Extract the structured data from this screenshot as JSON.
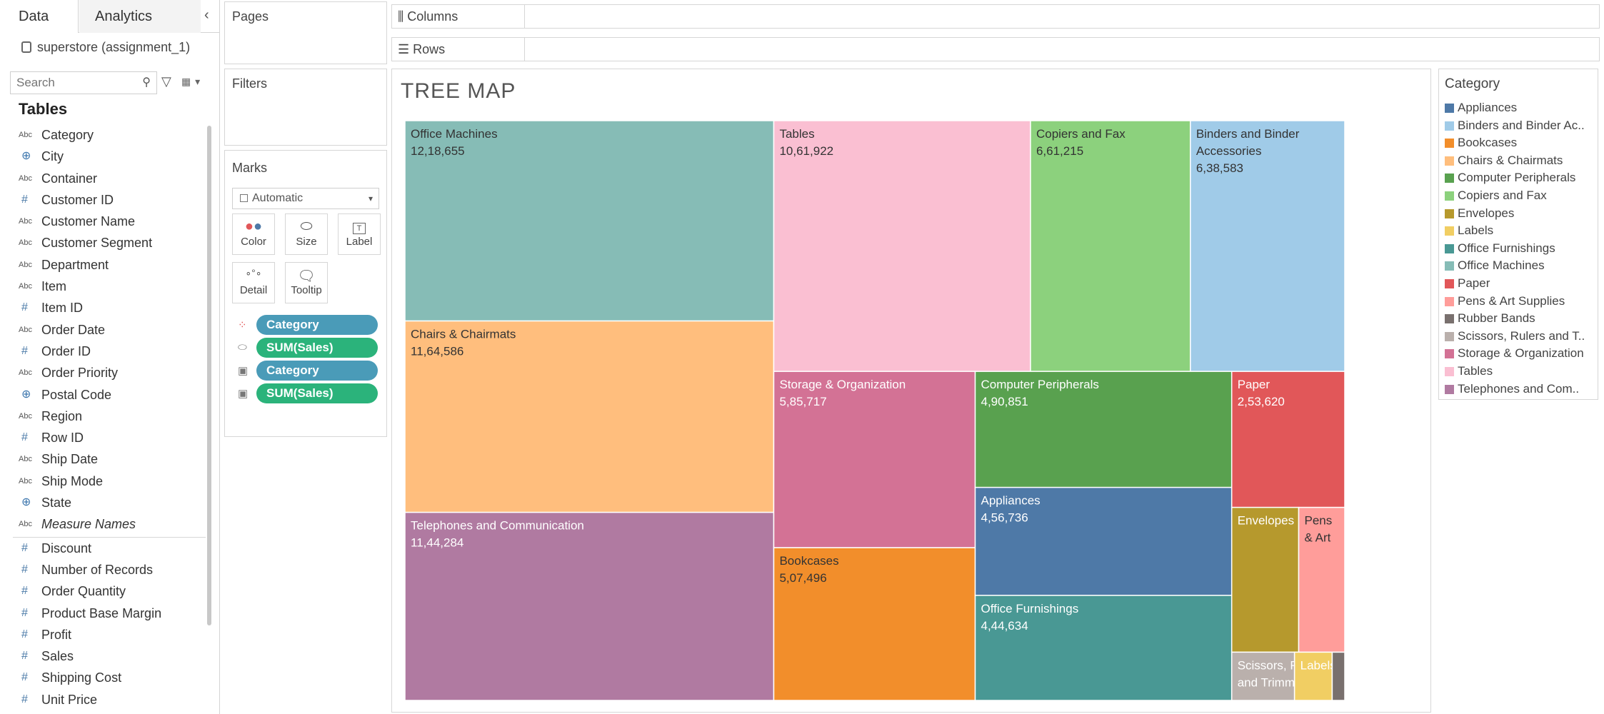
{
  "left_pane": {
    "tabs": [
      "Data",
      "Analytics"
    ],
    "datasource": "superstore (assignment_1)",
    "search_placeholder": "Search",
    "tables_title": "Tables",
    "dimensions": [
      {
        "name": "Category",
        "type": "Abc"
      },
      {
        "name": "City",
        "type": "geo"
      },
      {
        "name": "Container",
        "type": "Abc"
      },
      {
        "name": "Customer ID",
        "type": "#"
      },
      {
        "name": "Customer Name",
        "type": "Abc"
      },
      {
        "name": "Customer Segment",
        "type": "Abc"
      },
      {
        "name": "Department",
        "type": "Abc"
      },
      {
        "name": "Item",
        "type": "Abc"
      },
      {
        "name": "Item ID",
        "type": "#"
      },
      {
        "name": "Order Date",
        "type": "Abc"
      },
      {
        "name": "Order ID",
        "type": "#"
      },
      {
        "name": "Order Priority",
        "type": "Abc"
      },
      {
        "name": "Postal Code",
        "type": "geo"
      },
      {
        "name": "Region",
        "type": "Abc"
      },
      {
        "name": "Row ID",
        "type": "#"
      },
      {
        "name": "Ship Date",
        "type": "Abc"
      },
      {
        "name": "Ship Mode",
        "type": "Abc"
      },
      {
        "name": "State",
        "type": "geo"
      },
      {
        "name": "Measure Names",
        "type": "Abc",
        "italic": true
      }
    ],
    "measures": [
      {
        "name": "Discount",
        "type": "#"
      },
      {
        "name": "Number of Records",
        "type": "#"
      },
      {
        "name": "Order Quantity",
        "type": "#"
      },
      {
        "name": "Product Base Margin",
        "type": "#"
      },
      {
        "name": "Profit",
        "type": "#"
      },
      {
        "name": "Sales",
        "type": "#"
      },
      {
        "name": "Shipping Cost",
        "type": "#"
      },
      {
        "name": "Unit Price",
        "type": "#"
      }
    ]
  },
  "shelves": {
    "pages_title": "Pages",
    "filters_title": "Filters",
    "columns_label": "Columns",
    "rows_label": "Rows"
  },
  "marks": {
    "title": "Marks",
    "mark_type": "Automatic",
    "buttons": [
      "Color",
      "Size",
      "Label",
      "Detail",
      "Tooltip"
    ],
    "pills": [
      {
        "icon": "color",
        "label": "Category",
        "kind": "dim"
      },
      {
        "icon": "size",
        "label": "SUM(Sales)",
        "kind": "meas"
      },
      {
        "icon": "label",
        "label": "Category",
        "kind": "dim"
      },
      {
        "icon": "label",
        "label": "SUM(Sales)",
        "kind": "meas"
      }
    ]
  },
  "viz": {
    "title": "TREE MAP"
  },
  "legend": {
    "title": "Category",
    "items": [
      {
        "label": "Appliances",
        "color": "#4e79a7"
      },
      {
        "label": "Binders and Binder Ac..",
        "color": "#a0cbe8"
      },
      {
        "label": "Bookcases",
        "color": "#f28e2b"
      },
      {
        "label": "Chairs & Chairmats",
        "color": "#ffbe7d"
      },
      {
        "label": "Computer Peripherals",
        "color": "#59a14f"
      },
      {
        "label": "Copiers and Fax",
        "color": "#8cd17d"
      },
      {
        "label": "Envelopes",
        "color": "#b6992d"
      },
      {
        "label": "Labels",
        "color": "#f1ce63"
      },
      {
        "label": "Office Furnishings",
        "color": "#499894"
      },
      {
        "label": "Office Machines",
        "color": "#86bcb6"
      },
      {
        "label": "Paper",
        "color": "#e15759"
      },
      {
        "label": "Pens & Art Supplies",
        "color": "#ff9d9a"
      },
      {
        "label": "Rubber Bands",
        "color": "#79706e"
      },
      {
        "label": "Scissors, Rulers and T..",
        "color": "#bab0ac"
      },
      {
        "label": "Storage & Organization",
        "color": "#d37295"
      },
      {
        "label": "Tables",
        "color": "#fabfd2"
      },
      {
        "label": "Telephones and Com..",
        "color": "#b07aa1"
      }
    ]
  },
  "chart_data": {
    "type": "treemap",
    "title": "TREE MAP",
    "measure": "SUM(Sales)",
    "color_by": "Category",
    "items": [
      {
        "name": "Office Machines",
        "value": 1218655,
        "label": "12,18,655",
        "color": "#86bcb6"
      },
      {
        "name": "Chairs & Chairmats",
        "value": 1164586,
        "label": "11,64,586",
        "color": "#ffbe7d"
      },
      {
        "name": "Telephones and Communication",
        "value": 1144284,
        "label": "11,44,284",
        "color": "#b07aa1"
      },
      {
        "name": "Tables",
        "value": 1061922,
        "label": "10,61,922",
        "color": "#fabfd2"
      },
      {
        "name": "Copiers and Fax",
        "value": 661215,
        "label": "6,61,215",
        "color": "#8cd17d"
      },
      {
        "name": "Binders and Binder Accessories",
        "value": 638583,
        "label": "6,38,583",
        "color": "#a0cbe8"
      },
      {
        "name": "Storage & Organization",
        "value": 585717,
        "label": "5,85,717",
        "color": "#d37295"
      },
      {
        "name": "Computer Peripherals",
        "value": 490851,
        "label": "4,90,851",
        "color": "#59a14f"
      },
      {
        "name": "Bookcases",
        "value": 507496,
        "label": "5,07,496",
        "color": "#f28e2b"
      },
      {
        "name": "Appliances",
        "value": 456736,
        "label": "4,56,736",
        "color": "#4e79a7"
      },
      {
        "name": "Office Furnishings",
        "value": 444634,
        "label": "4,44,634",
        "color": "#499894"
      },
      {
        "name": "Paper",
        "value": 253620,
        "label": "2,53,620",
        "color": "#e15759"
      },
      {
        "name": "Envelopes",
        "value": 160000,
        "label": "",
        "color": "#b6992d"
      },
      {
        "name": "Pens & Art Supplies",
        "value": 110000,
        "display": [
          "Pens",
          "& Art"
        ],
        "label": "",
        "color": "#ff9d9a"
      },
      {
        "name": "Scissors, Rulers and Trimmers",
        "value": 50000,
        "label": "",
        "color": "#bab0ac"
      },
      {
        "name": "Labels",
        "value": 30000,
        "label": "",
        "color": "#f1ce63"
      },
      {
        "name": "Rubber Bands",
        "value": 10000,
        "label": "",
        "color": "#79706e"
      }
    ]
  }
}
